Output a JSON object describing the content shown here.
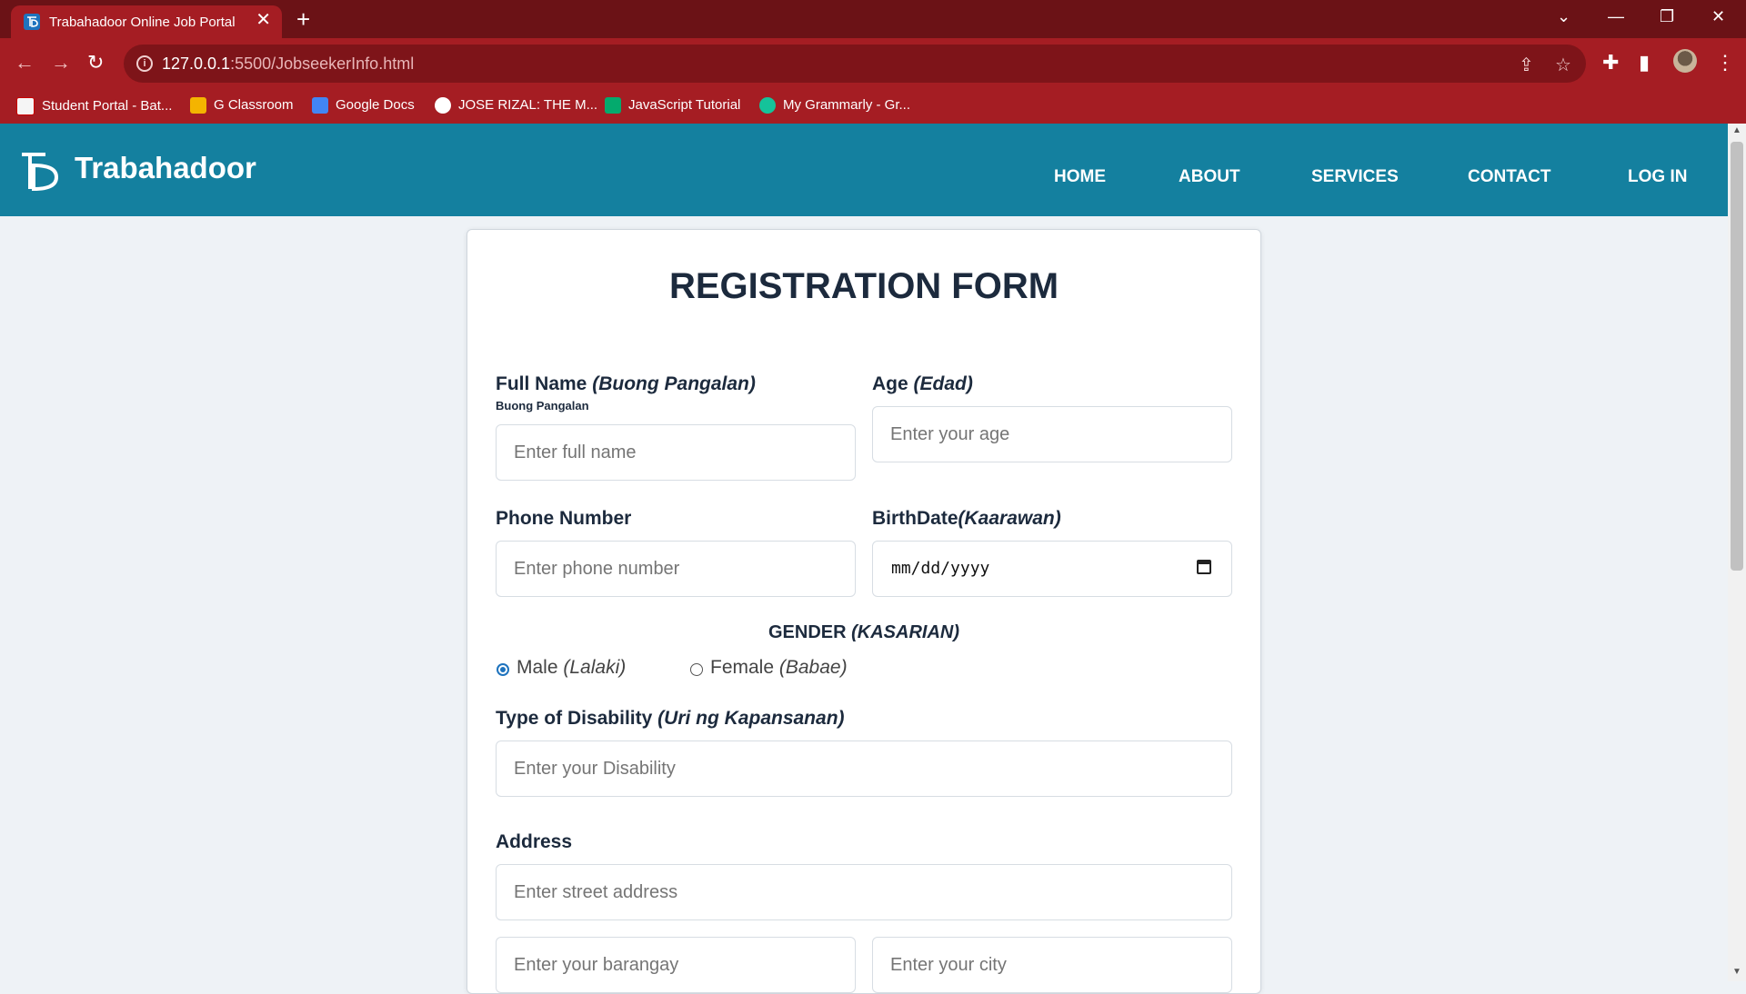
{
  "browser": {
    "tab_title": "Trabahadoor Online Job Portal",
    "tab_close": "✕",
    "new_tab": "+",
    "url_host": "127.0.0.1",
    "url_path": ":5500/JobseekerInfo.html",
    "bookmarks": [
      {
        "label": "Student Portal - Bat...",
        "icon_color": "#f5f5f5"
      },
      {
        "label": "G Classroom",
        "icon_color": "#f4b400"
      },
      {
        "label": "Google Docs",
        "icon_color": "#4285f4"
      },
      {
        "label": "JOSE RIZAL: THE M...",
        "icon_color": "#ffffff"
      },
      {
        "label": "JavaScript Tutorial",
        "icon_color": "#04aa6d"
      },
      {
        "label": "My Grammarly - Gr...",
        "icon_color": "#15c39a"
      }
    ]
  },
  "site": {
    "brand": "Trabahadoor",
    "nav": [
      "HOME",
      "ABOUT",
      "SERVICES",
      "CONTACT",
      "LOG IN"
    ],
    "header_color": "#14809f"
  },
  "form": {
    "title": "REGISTRATION FORM",
    "full_name": {
      "label": "Full Name",
      "label_alt": "(Buong Pangalan)",
      "sublabel": "Buong Pangalan",
      "placeholder": "Enter full name"
    },
    "age": {
      "label": "Age",
      "label_alt": "(Edad)",
      "placeholder": "Enter your age"
    },
    "phone": {
      "label": "Phone Number",
      "placeholder": "Enter phone number"
    },
    "birthdate": {
      "label": "BirthDate",
      "label_alt": "(Kaarawan)",
      "value": "mm/dd/yyyy"
    },
    "gender": {
      "label": "GENDER",
      "label_alt": "(KASARIAN)",
      "options": [
        {
          "label": "Male",
          "label_alt": "(Lalaki)",
          "selected": true
        },
        {
          "label": "Female",
          "label_alt": "(Babae)",
          "selected": false
        }
      ]
    },
    "disability": {
      "label": "Type of Disability",
      "label_alt": "(Uri ng Kapansanan)",
      "placeholder": "Enter your Disability"
    },
    "address": {
      "label": "Address",
      "street_placeholder": "Enter street address",
      "barangay_placeholder": "Enter your barangay",
      "city_placeholder": "Enter your city"
    }
  }
}
